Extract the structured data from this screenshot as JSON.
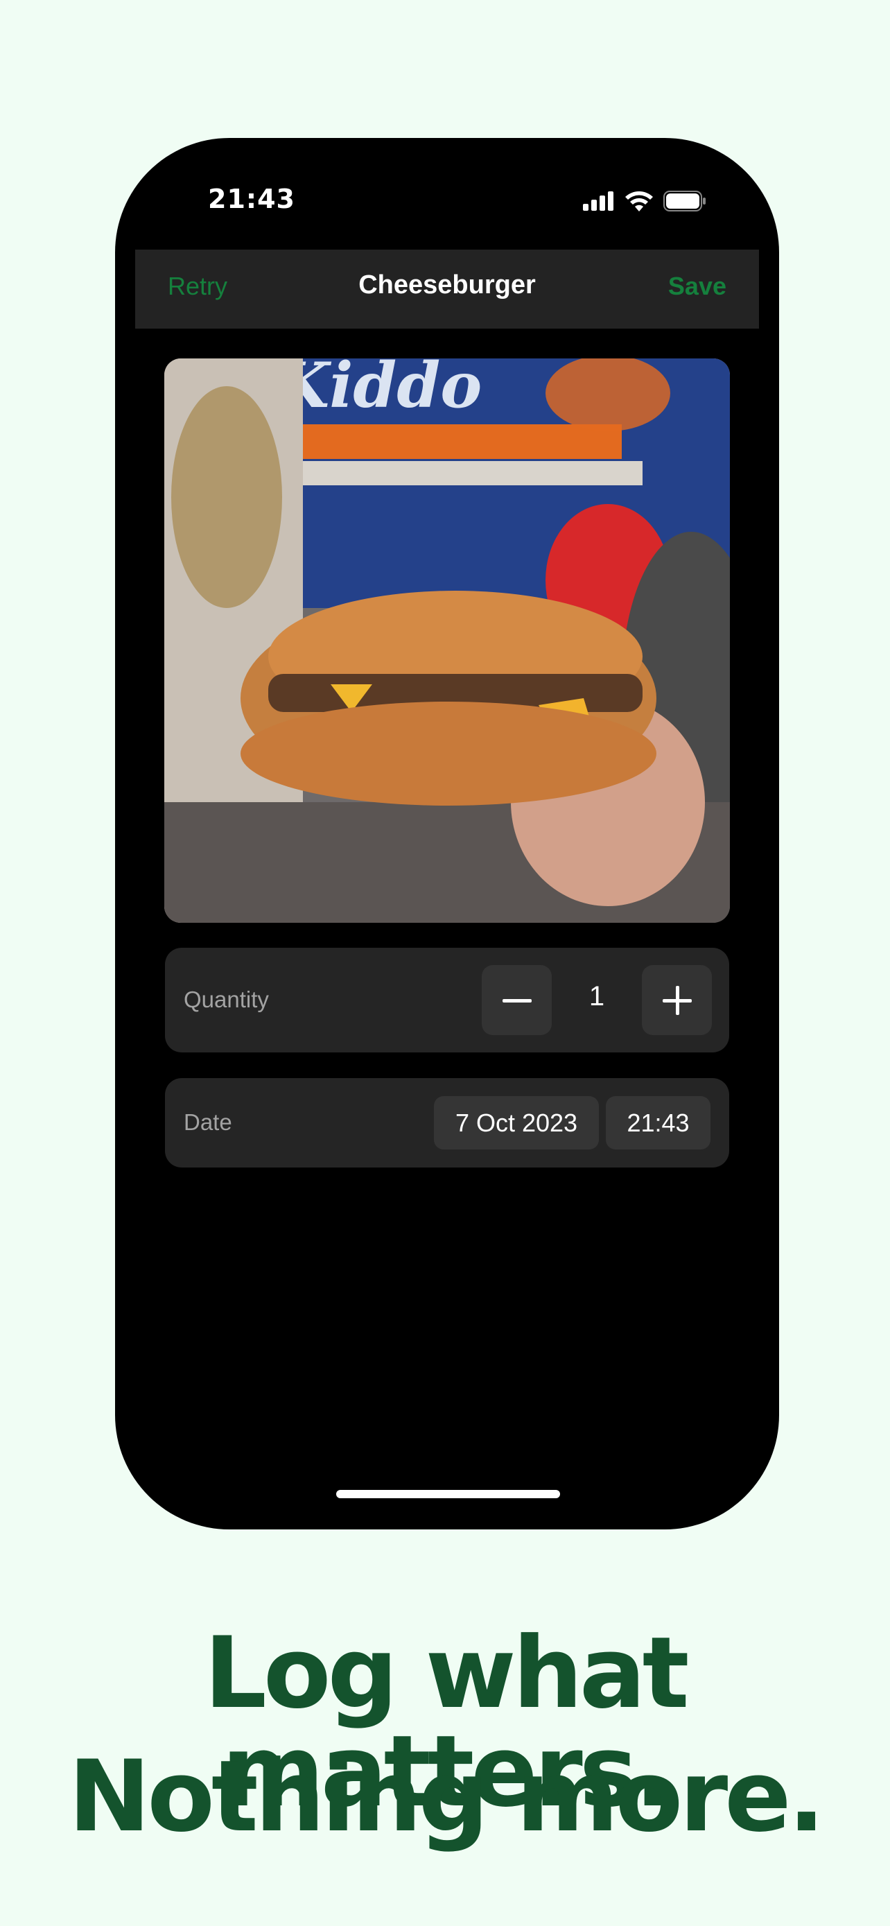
{
  "status": {
    "time": "21:43"
  },
  "navbar": {
    "left_action": "Retry",
    "title": "Cheeseburger",
    "right_action": "Save"
  },
  "photo": {
    "description_icon": "food-photo"
  },
  "quantity": {
    "label": "Quantity",
    "value": "1"
  },
  "date": {
    "label": "Date",
    "date_value": "7 Oct 2023",
    "time_value": "21:43"
  },
  "tagline": {
    "line1": "Log what matters.",
    "line2": "Nothing more."
  },
  "colors": {
    "accent": "#15803d",
    "background": "#f0fdf4",
    "tagline": "#14532d"
  }
}
